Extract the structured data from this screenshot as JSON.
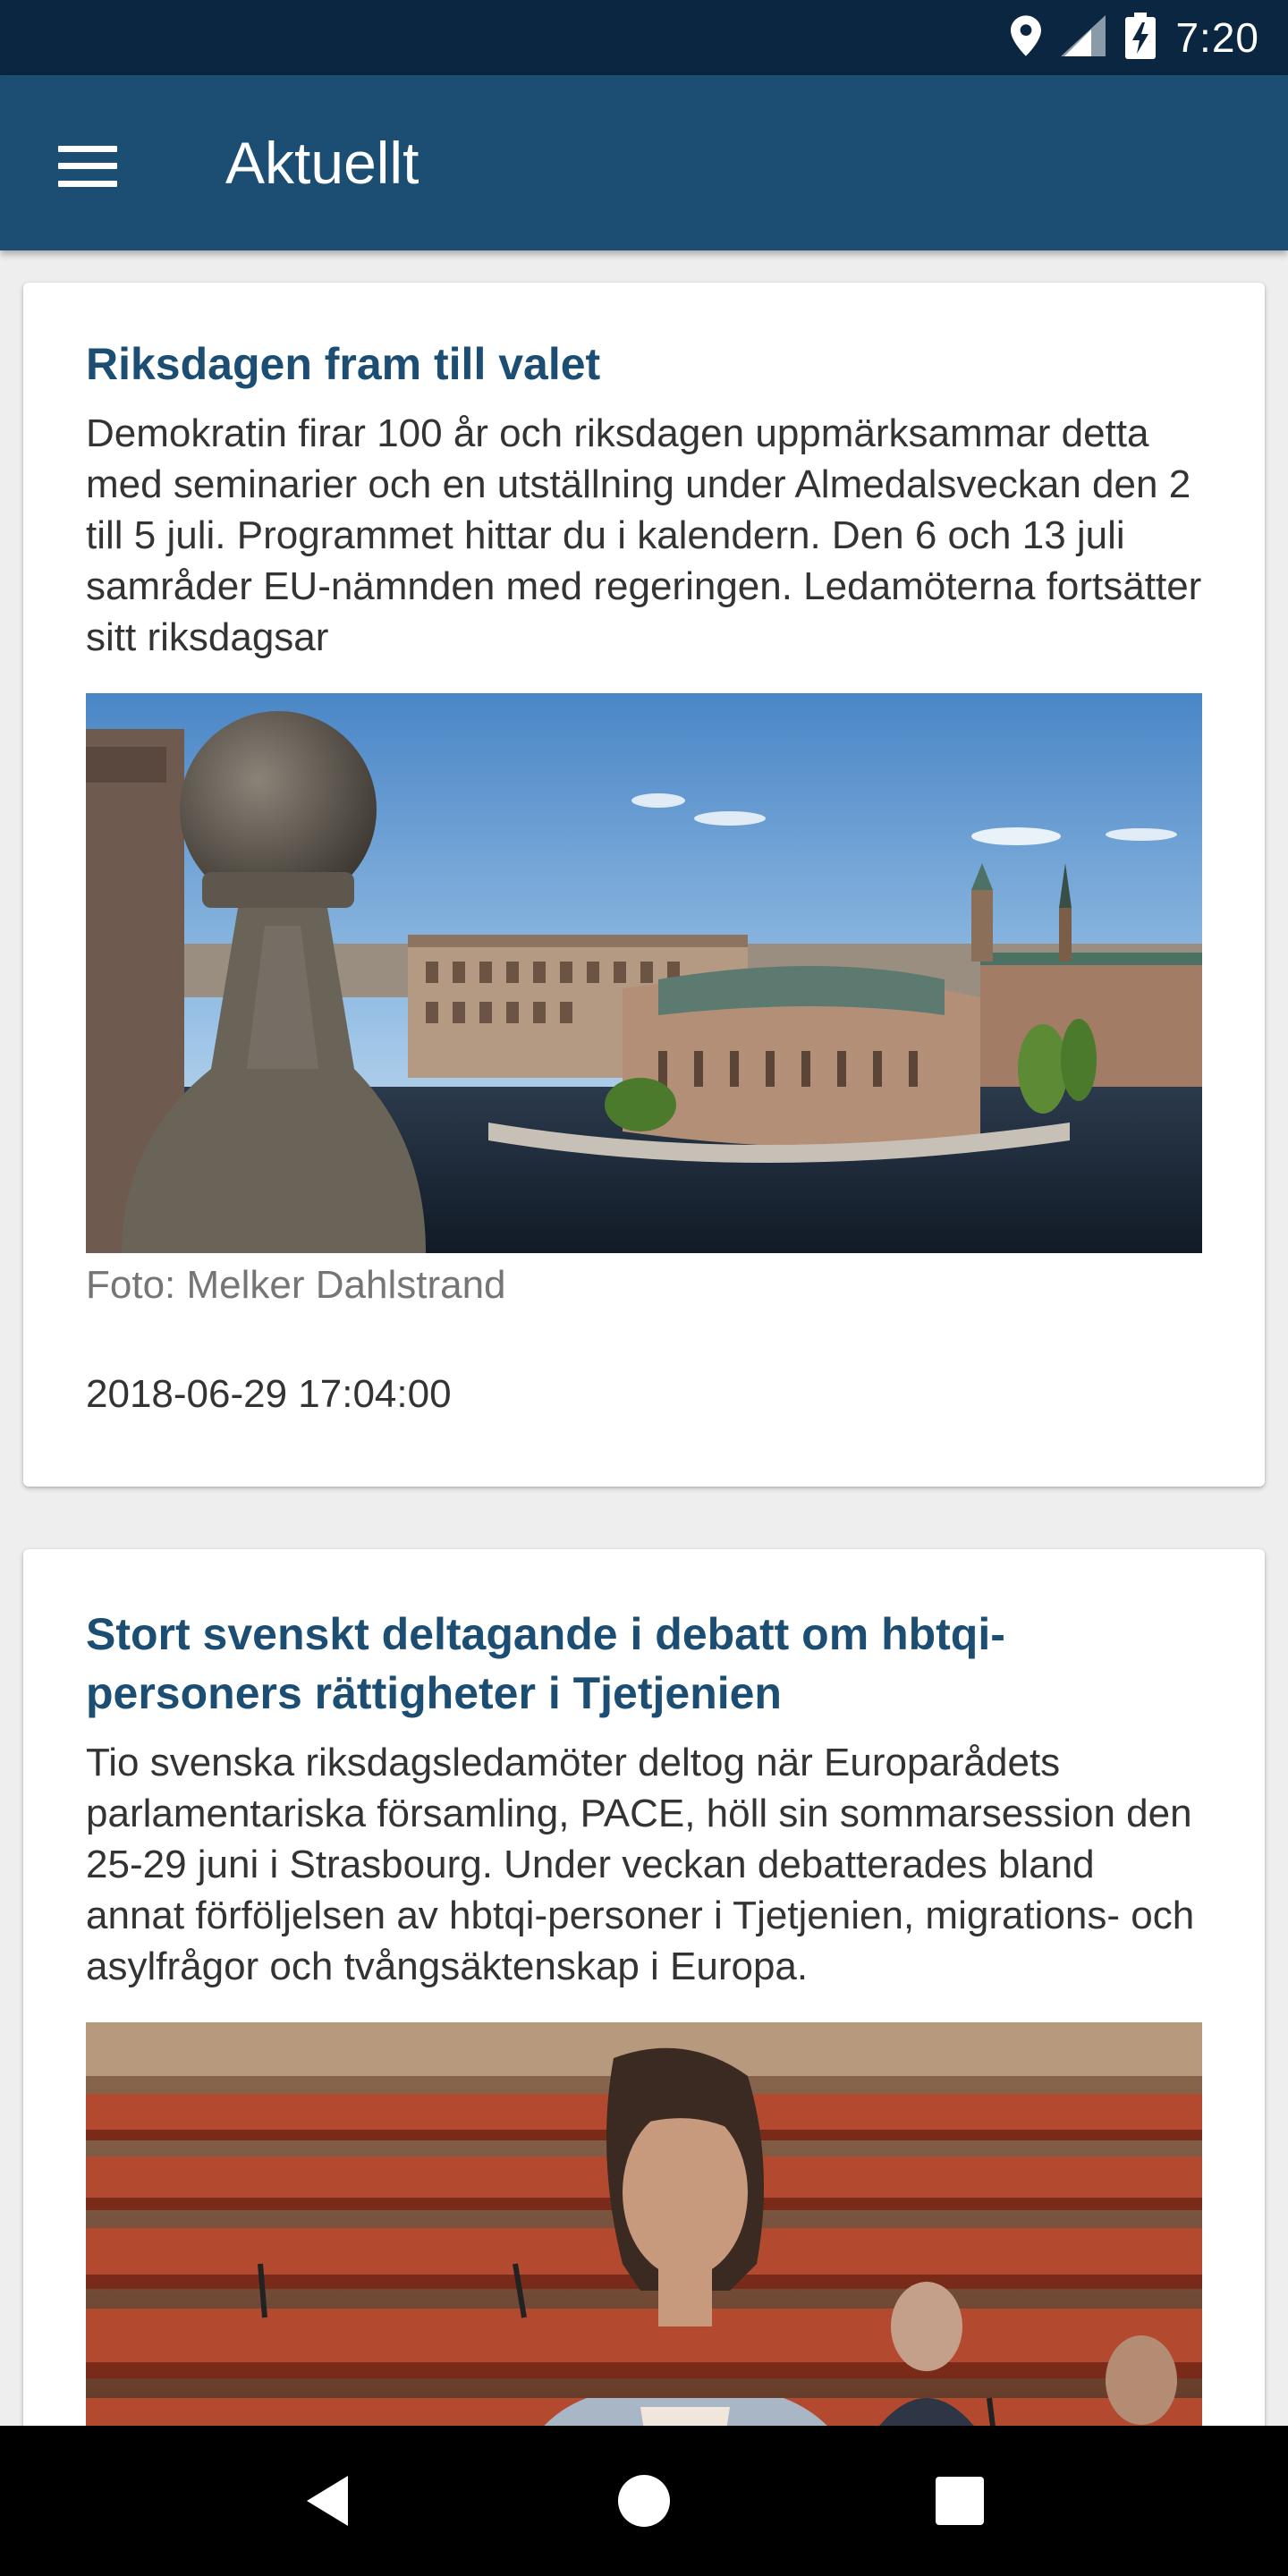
{
  "status_bar": {
    "time": "7:20",
    "icons": [
      "location-icon",
      "signal-icon",
      "battery-charging-icon"
    ]
  },
  "app_bar": {
    "title": "Aktuellt",
    "menu_icon": "hamburger-menu-icon",
    "background": "#1c4e74"
  },
  "articles": [
    {
      "title": "Riksdagen fram till valet",
      "body": "Demokratin firar 100 år och riksdagen uppmärksammar detta med seminarier och en utställning under Almedalsveckan den 2 till 5 juli. Programmet hittar du i kalendern. Den 6 och 13 juli samråder EU-nämnden med regeringen. Ledamöterna fortsätter sitt riksdagsar",
      "photo_caption": "Foto: Melker Dahlstrand",
      "date": "2018-06-29 17:04:00"
    },
    {
      "title": "Stort svenskt deltagande i debatt om hbtqi-personers rättigheter i Tjetjenien",
      "body": "Tio svenska riksdagsledamöter deltog när Europarådets parlamentariska församling, PACE, höll sin sommarsession den 25-29 juni i Strasbourg. Under veckan debatterades bland annat förföljelsen av hbtqi-personer i Tjetjenien, migrations- och asylfrågor och tvångsäktenskap i Europa."
    }
  ],
  "nav_bar": {
    "buttons": [
      "back-icon",
      "home-icon",
      "recents-icon"
    ]
  },
  "colors": {
    "status_bar": "#0a2640",
    "title_text": "#1c4e74",
    "background": "#eeeeee"
  }
}
